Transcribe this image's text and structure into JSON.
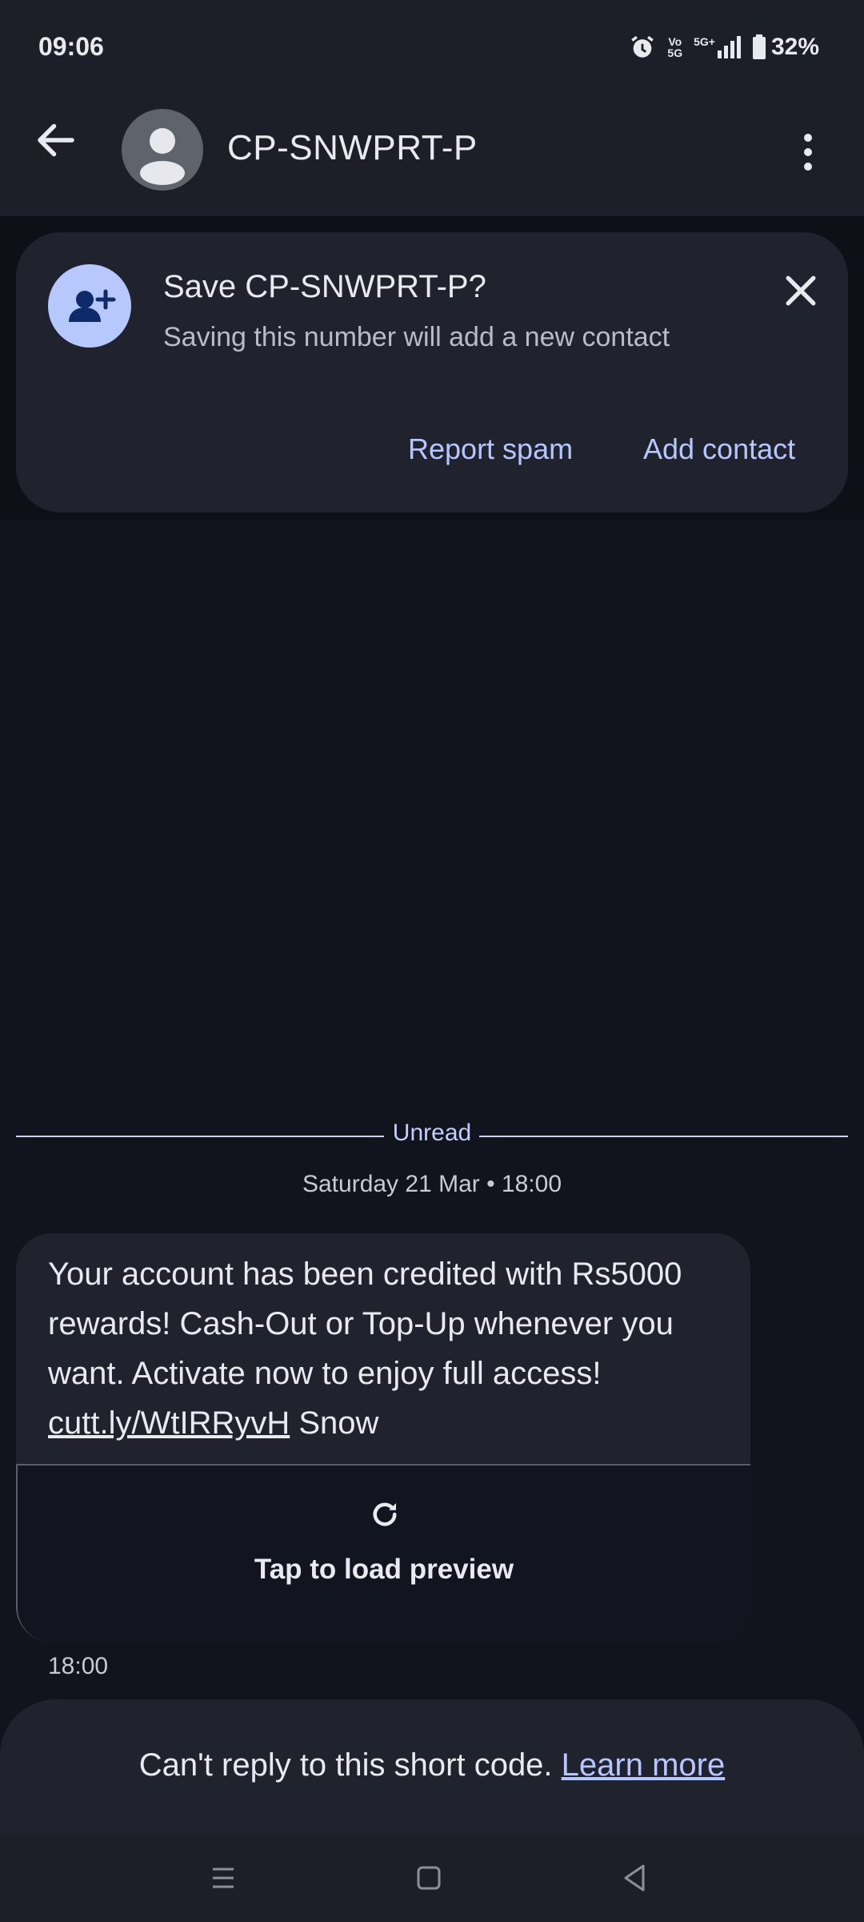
{
  "status_bar": {
    "time": "09:06",
    "volte_line1": "Vo",
    "volte_line2": "5G",
    "network": "5G+",
    "battery": "32%",
    "icons": [
      "alarm-icon",
      "volte-icon",
      "signal-icon",
      "battery-icon"
    ]
  },
  "header": {
    "title": "CP-SNWPRT-P",
    "icons": [
      "back-arrow-icon",
      "avatar-person-icon",
      "more-vert-icon"
    ]
  },
  "banner": {
    "title": "Save CP-SNWPRT-P?",
    "subtitle": "Saving this number will add a new contact",
    "report_spam": "Report spam",
    "add_contact": "Add contact",
    "icons": [
      "person-add-icon",
      "close-icon"
    ]
  },
  "conversation": {
    "unread_label": "Unread",
    "date": "Saturday 21 Mar • 18:00",
    "message": {
      "text_before_link": "Your account has been credited with Rs5000 rewards! Cash-Out or Top-Up whenever you want. Activate now to enjoy full access! ",
      "link": "cutt.ly/WtIRRyvH",
      "text_after_link": " Snow",
      "preview_label": "Tap to load preview",
      "time": "18:00"
    }
  },
  "reply": {
    "text": "Can't reply to this short code. ",
    "link": "Learn more"
  },
  "nav": {
    "icons": [
      "recents-icon",
      "home-icon",
      "back-icon"
    ]
  },
  "colors": {
    "background": "#11141c",
    "surface": "#20232d",
    "accent": "#b6c6ff"
  }
}
